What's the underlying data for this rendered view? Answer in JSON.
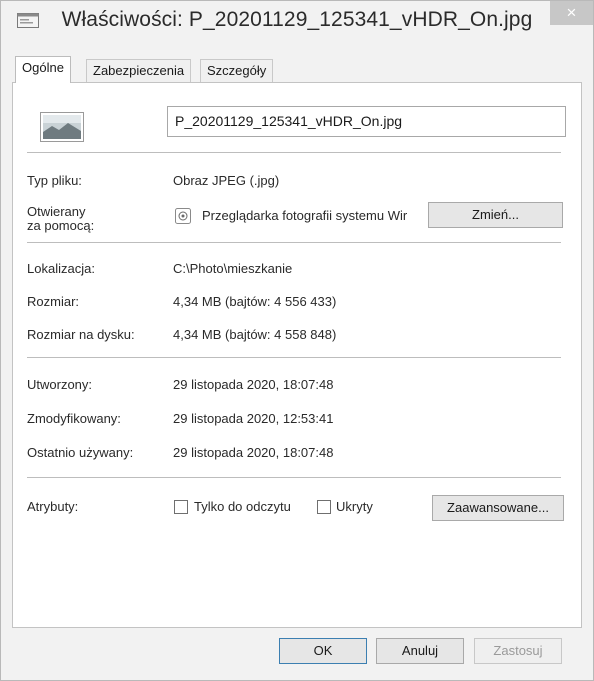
{
  "window": {
    "title": "Właściwości: P_20201129_125341_vHDR_On.jpg",
    "close_glyph": "×",
    "title_icon": "properties-icon"
  },
  "tabs": [
    {
      "label": "Ogólne",
      "active": true
    },
    {
      "label": "Zabezpieczenia",
      "active": false
    },
    {
      "label": "Szczegóły",
      "active": false
    }
  ],
  "general": {
    "file_icon": "image-file-icon",
    "file_name": "P_20201129_125341_vHDR_On.jpg",
    "type_label": "Typ pliku:",
    "type_value": "Obraz JPEG (.jpg)",
    "opens_with_label_1": "Otwierany",
    "opens_with_label_2": "za pomocą:",
    "opens_with_value": "Przeglądarka fotografii systemu Wir",
    "opens_with_icon": "photo-viewer-icon",
    "change_button": "Zmień...",
    "location_label": "Lokalizacja:",
    "location_value": "C:\\Photo\\mieszkanie",
    "size_label": "Rozmiar:",
    "size_value": "4,34 MB (bajtów: 4 556 433)",
    "size_on_disk_label": "Rozmiar na dysku:",
    "size_on_disk_value": "4,34 MB (bajtów: 4 558 848)",
    "created_label": "Utworzony:",
    "created_value": "29 listopada 2020, 18:07:48",
    "modified_label": "Zmodyfikowany:",
    "modified_value": "29 listopada 2020, 12:53:41",
    "accessed_label": "Ostatnio używany:",
    "accessed_value": "29 listopada 2020, 18:07:48",
    "attributes_label": "Atrybuty:",
    "readonly_label": "Tylko do odczytu",
    "readonly_checked": false,
    "hidden_label": "Ukryty",
    "hidden_checked": false,
    "advanced_button": "Zaawansowane..."
  },
  "footer": {
    "ok": "OK",
    "cancel": "Anuluj",
    "apply": "Zastosuj"
  }
}
